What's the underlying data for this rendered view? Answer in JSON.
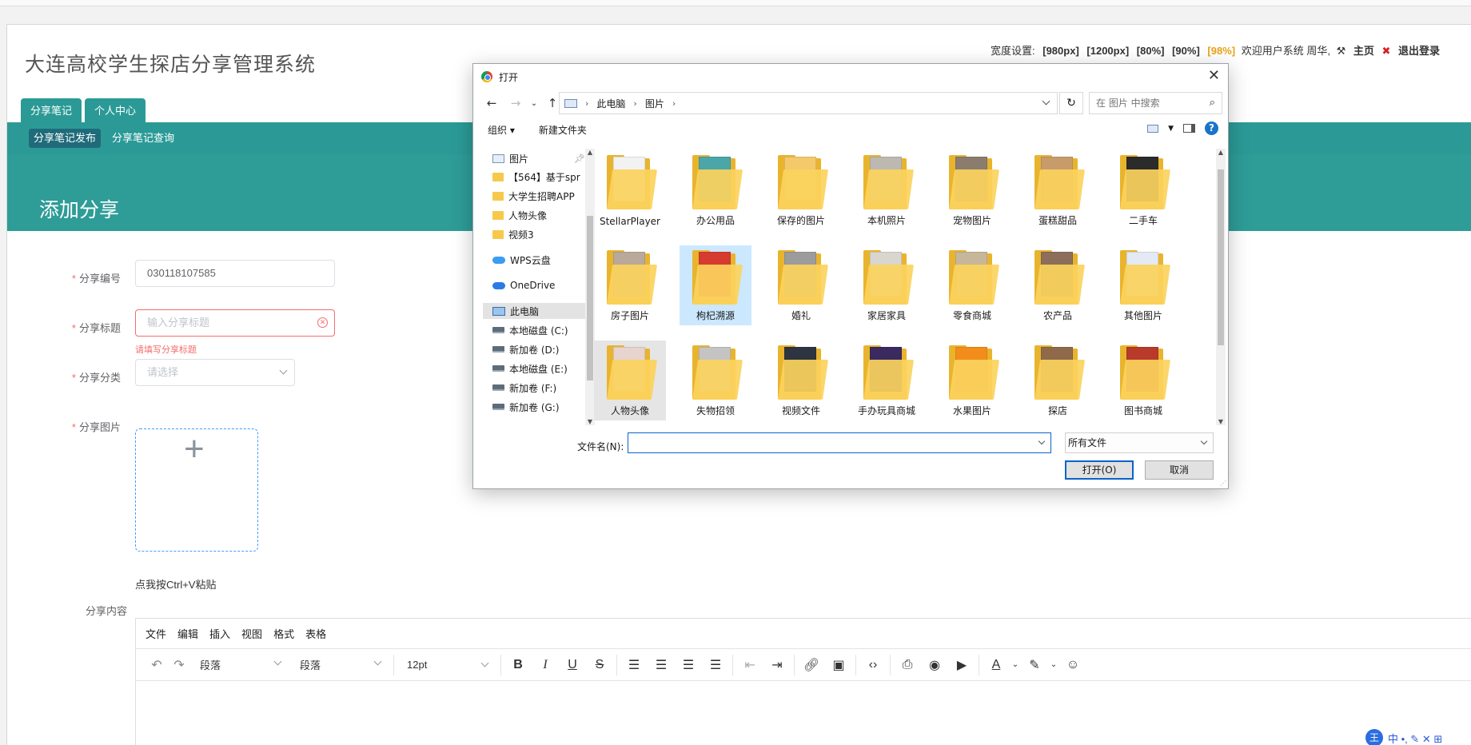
{
  "app": {
    "title": "大连高校学生探店分享管理系统",
    "width_settings": {
      "label": "宽度设置:",
      "options": [
        "[980px]",
        "[1200px]",
        "[80%]",
        "[90%]",
        "[98%]"
      ],
      "active_option": "[98%]"
    },
    "welcome": "欢迎用户系统 周华,",
    "home_link": "主页",
    "logout_link": "退出登录",
    "tabs": [
      "分享笔记",
      "个人中心"
    ],
    "subnav": [
      "分享笔记发布",
      "分享笔记查询"
    ],
    "page_header": "添加分享",
    "form": {
      "id_label": "分享编号",
      "id_value": "030118107585",
      "title_label": "分享标题",
      "title_placeholder": "输入分享标题",
      "title_error": "请填写分享标题",
      "category_label": "分享分类",
      "category_placeholder": "请选择",
      "image_label": "分享图片",
      "paste_hint": "点我按Ctrl+V粘贴",
      "content_label": "分享内容"
    },
    "editor": {
      "menus": [
        "文件",
        "编辑",
        "插入",
        "视图",
        "格式",
        "表格"
      ],
      "block_format_1": "段落",
      "block_format_2": "段落",
      "font_size": "12pt"
    },
    "ime": {
      "badge": "王",
      "text": "中 •, ✎ ✕ ⊞"
    }
  },
  "dialog": {
    "title": "打开",
    "breadcrumb": [
      "此电脑",
      "图片"
    ],
    "search_placeholder": "在 图片 中搜索",
    "organize": "组织 ▾",
    "new_folder": "新建文件夹",
    "nav_items": [
      {
        "label": "图片",
        "icon": "pictures-icon",
        "pinned": true
      },
      {
        "label": "【564】基于spr",
        "icon": "folder-icon"
      },
      {
        "label": "大学生招聘APP",
        "icon": "folder-icon"
      },
      {
        "label": "人物头像",
        "icon": "folder-icon"
      },
      {
        "label": "视频3",
        "icon": "folder-icon"
      },
      {
        "label": "WPS云盘",
        "icon": "cloud-icon"
      },
      {
        "label": "OneDrive",
        "icon": "cloud-icon"
      },
      {
        "label": "此电脑",
        "icon": "computer-icon",
        "selected": true
      },
      {
        "label": "本地磁盘 (C:)",
        "icon": "drive-icon"
      },
      {
        "label": "新加卷 (D:)",
        "icon": "drive-icon"
      },
      {
        "label": "本地磁盘 (E:)",
        "icon": "drive-icon"
      },
      {
        "label": "新加卷 (F:)",
        "icon": "drive-icon"
      },
      {
        "label": "新加卷 (G:)",
        "icon": "drive-icon"
      }
    ],
    "folders": [
      {
        "label": "StellarPlayer",
        "color": "#f2f2f2"
      },
      {
        "label": "办公用品",
        "color": "#4aa6a9"
      },
      {
        "label": "保存的图片",
        "color": "#f3c96a"
      },
      {
        "label": "本机照片",
        "color": "#bdb8b0"
      },
      {
        "label": "宠物图片",
        "color": "#8a7d6e"
      },
      {
        "label": "蛋糕甜品",
        "color": "#c89b6a"
      },
      {
        "label": "二手车",
        "color": "#2b2b2b"
      },
      {
        "label": "房子图片",
        "color": "#b8a99a"
      },
      {
        "label": "枸杞溯源",
        "color": "#d63b2f",
        "state": "selected"
      },
      {
        "label": "婚礼",
        "color": "#9c9c9c"
      },
      {
        "label": "家居家具",
        "color": "#d9d6d0"
      },
      {
        "label": "零食商城",
        "color": "#c7b79a"
      },
      {
        "label": "农产品",
        "color": "#8c6e5a"
      },
      {
        "label": "其他图片",
        "color": "#e4eaf3"
      },
      {
        "label": "人物头像",
        "color": "#e7d4cf",
        "state": "hover"
      },
      {
        "label": "失物招领",
        "color": "#c4c4c4"
      },
      {
        "label": "视频文件",
        "color": "#2e3440"
      },
      {
        "label": "手办玩具商城",
        "color": "#3a2a60"
      },
      {
        "label": "水果图片",
        "color": "#f28d1c"
      },
      {
        "label": "探店",
        "color": "#8f6a4a"
      },
      {
        "label": "图书商城",
        "color": "#b83a2a"
      }
    ],
    "filename_label": "文件名(N):",
    "filename_value": "",
    "filetype": "所有文件",
    "open_button": "打开(O)",
    "cancel_button": "取消"
  }
}
